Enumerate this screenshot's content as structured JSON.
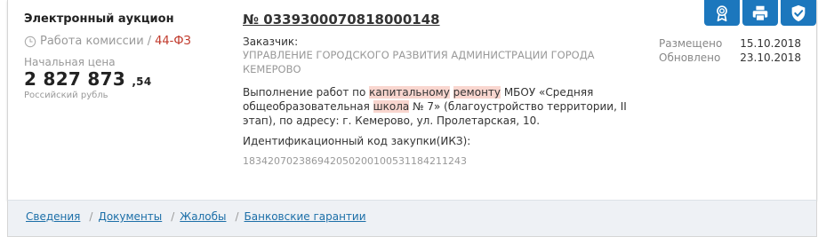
{
  "card": {
    "procurement_type": "Электронный аукцион",
    "status": "Работа комиссии",
    "status_separator": "/",
    "law": "44-ФЗ",
    "price_label": "Начальная цена",
    "price_main": "2 827 873",
    "price_cents": ",54",
    "currency": "Российский рубль",
    "reg_number": "№ 0339300070818000148",
    "customer_label": "Заказчик:",
    "customer_name": "УПРАВЛЕНИЕ ГОРОДСКОГО РАЗВИТИЯ АДМИНИСТРАЦИИ ГОРОДА КЕМЕРОВО",
    "subject": {
      "part1": "Выполнение работ по ",
      "hl1": "капитальному",
      "part2": " ",
      "hl2": "ремонту",
      "part3": " МБОУ «Средняя общеобразовательная ",
      "hl3": "школа",
      "part4": " № 7» (благоустройство территории, II этап), по адресу: г. Кемерово, ул. Пролетарская, 10."
    },
    "ikz_label": "Идентификационный код закупки(ИКЗ):",
    "ikz": "183420702386942050200100531184211243",
    "dates": {
      "placed_label": "Размещено",
      "placed": "15.10.2018",
      "updated_label": "Обновлено",
      "updated": "23.10.2018"
    },
    "action_icons": [
      "award-icon",
      "print-icon",
      "shield-check-icon"
    ]
  },
  "footer": {
    "tabs": [
      "Сведения",
      "Документы",
      "Жалобы",
      "Банковские гарантии"
    ],
    "separator": "/"
  },
  "colors": {
    "accent": "#1c77bd",
    "link": "#1c6fa8",
    "law": "#c0392b",
    "highlight": "#f9d6cf",
    "footer_bg": "#eef1f5"
  }
}
